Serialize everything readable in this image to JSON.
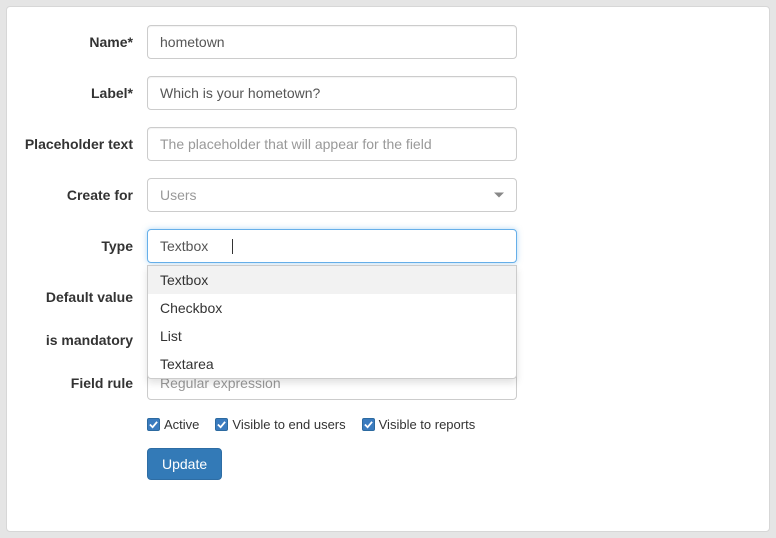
{
  "fields": {
    "name": {
      "label": "Name*",
      "value": "hometown"
    },
    "label": {
      "label": "Label*",
      "value": "Which is your hometown?"
    },
    "placeholder": {
      "label": "Placeholder text",
      "placeholder": "The placeholder that will appear for the field"
    },
    "createFor": {
      "label": "Create for",
      "selected": "Users"
    },
    "type": {
      "label": "Type",
      "selected": "Textbox",
      "options": [
        "Textbox",
        "Checkbox",
        "List",
        "Textarea"
      ]
    },
    "defaultValue": {
      "label": "Default value"
    },
    "isMandatory": {
      "label": "is mandatory"
    },
    "fieldRule": {
      "label": "Field rule",
      "placeholder": "Regular expression"
    }
  },
  "checkboxes": {
    "active": {
      "label": "Active",
      "checked": true
    },
    "visibleEndUsers": {
      "label": "Visible to end users",
      "checked": true
    },
    "visibleReports": {
      "label": "Visible to reports",
      "checked": true
    }
  },
  "buttons": {
    "update": "Update"
  }
}
